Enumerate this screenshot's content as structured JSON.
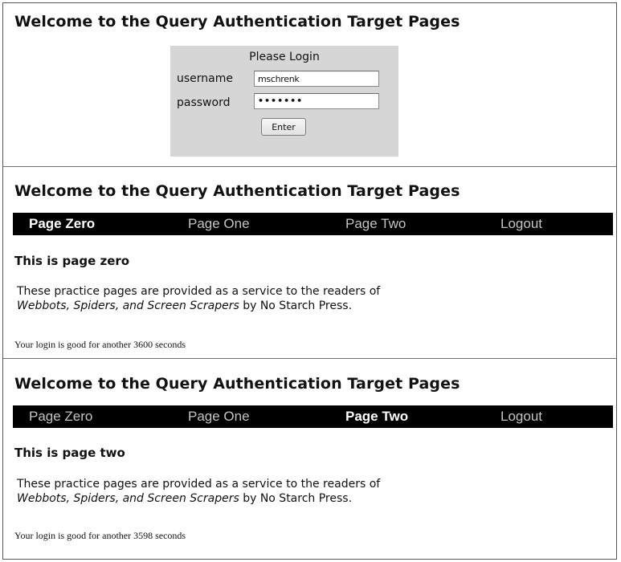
{
  "sections": [
    {
      "title": "Welcome to the Query Authentication Target Pages",
      "login": {
        "heading": "Please Login",
        "username_label": "username",
        "username_value": "mschrenk",
        "password_label": "password",
        "password_value": "•••••••",
        "enter_label": "Enter"
      }
    },
    {
      "title": "Welcome to the Query Authentication Target Pages",
      "nav": [
        "Page Zero",
        "Page One",
        "Page Two",
        "Logout"
      ],
      "active_nav": "Page Zero",
      "page_heading": "This is page zero",
      "para_line1": "These practice pages are provided as a service to the readers of",
      "para_book": "Webbots, Spiders, and Screen Scrapers",
      "para_by": " by No Starch Press.",
      "status": "Your login is good for another 3600 seconds"
    },
    {
      "title": "Welcome to the Query Authentication Target Pages",
      "nav": [
        "Page Zero",
        "Page One",
        "Page Two",
        "Logout"
      ],
      "active_nav": "Page Two",
      "page_heading": "This is page two",
      "para_line1": "These practice pages are provided as a service to the readers of",
      "para_book": "Webbots, Spiders, and Screen Scrapers",
      "para_by": " by No Starch Press.",
      "status": "Your login is good for another 3598 seconds"
    }
  ],
  "colors": {
    "nav_background": "#000000",
    "nav_active_text": "#ffffff",
    "nav_inactive_text": "#c4c4c4",
    "login_background": "#d6d6d6"
  }
}
